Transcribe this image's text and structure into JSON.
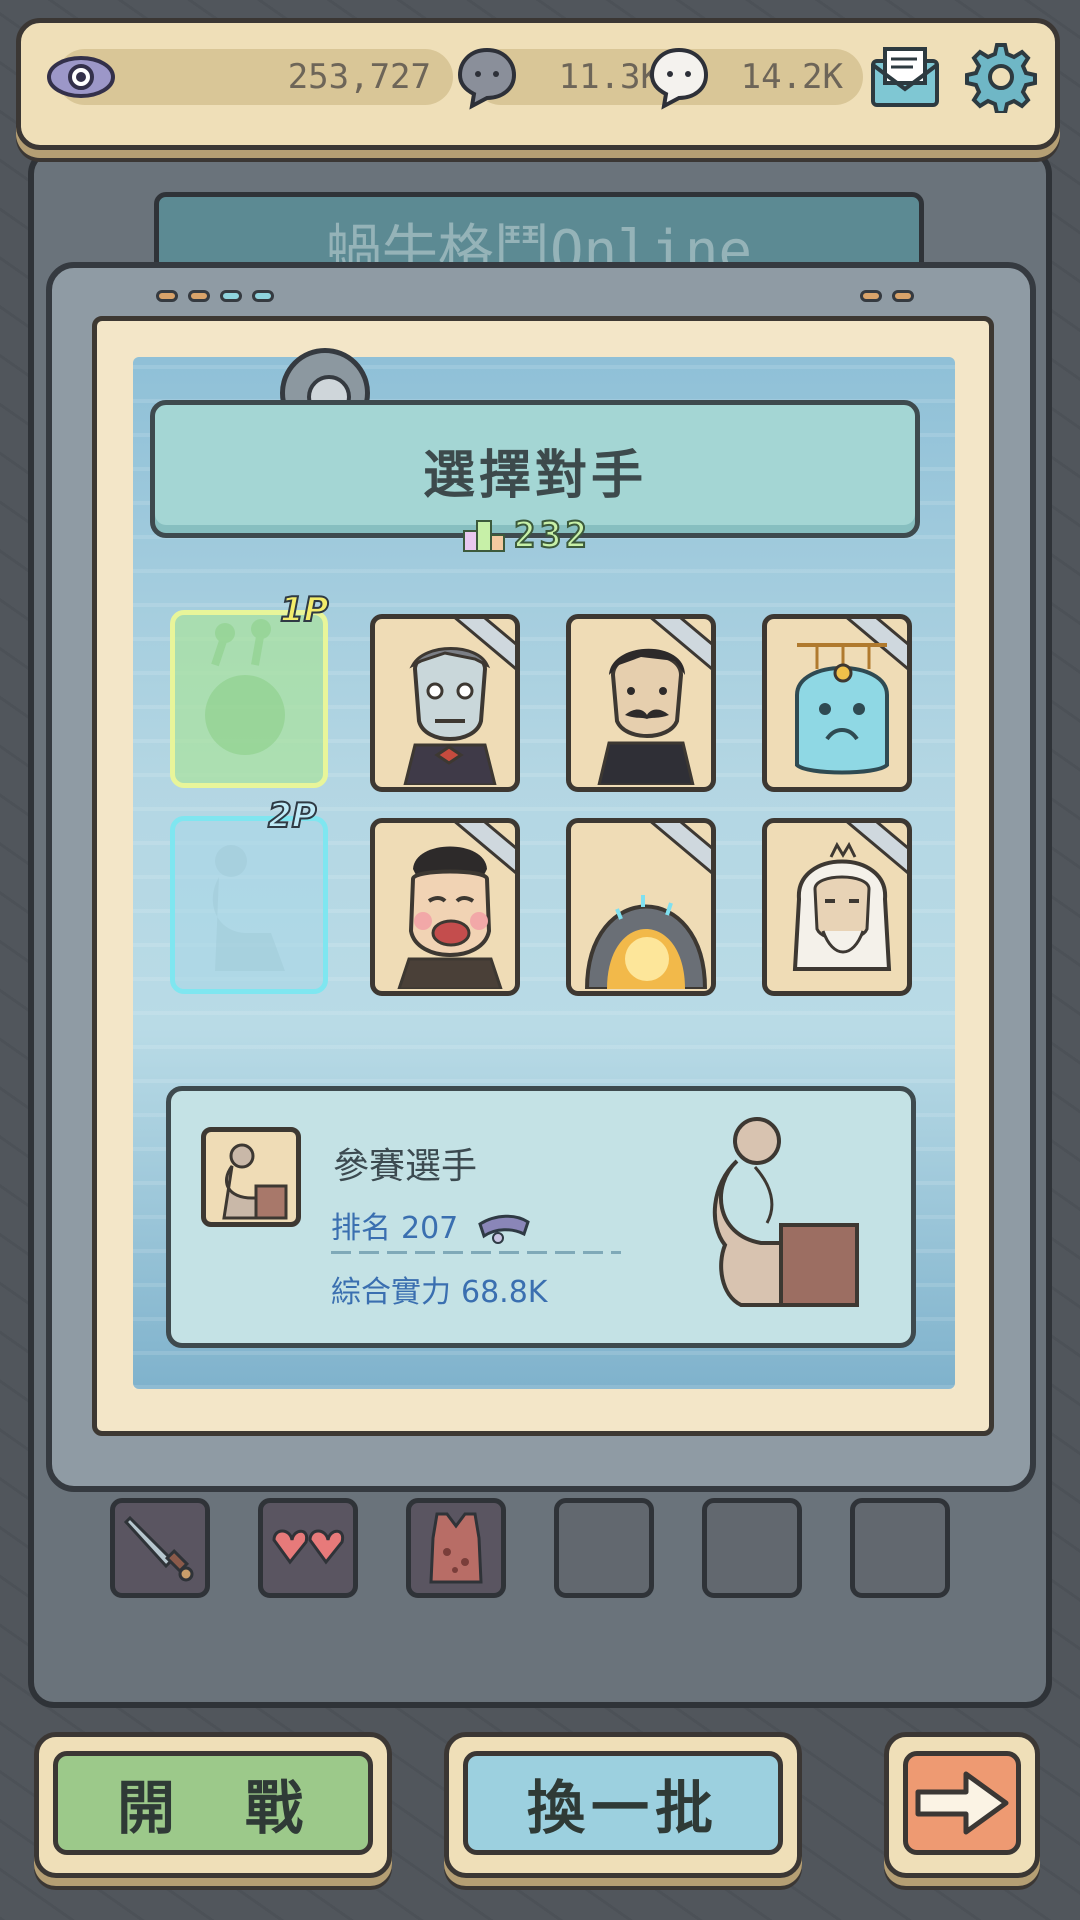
{
  "topbar": {
    "views_icon": "eye-icon",
    "views_value": "253,727",
    "dark_bubble_icon": "dark-speech-bubble-icon",
    "dark_bubble_value": "11.3K",
    "light_bubble_icon": "light-speech-bubble-icon",
    "light_bubble_value": "14.2K",
    "mail_icon": "mail-icon",
    "settings_icon": "gear-icon"
  },
  "background": {
    "screen_text": "蝸牛格鬥Online"
  },
  "dialog": {
    "title": "選擇對手",
    "rank_icon": "podium-icon",
    "rank_value": "232"
  },
  "slots": {
    "p1_label": "1P",
    "p2_label": "2P"
  },
  "opponents": [
    {
      "name": "old-man-vampire-portrait"
    },
    {
      "name": "mustache-gentleman-portrait"
    },
    {
      "name": "blue-ghost-portrait"
    },
    {
      "name": "crying-lady-portrait"
    },
    {
      "name": "golden-portal-portrait"
    },
    {
      "name": "white-haired-sage-portrait"
    }
  ],
  "info": {
    "name": "參賽選手",
    "rank_label": "排名",
    "rank_value": "207",
    "power_label": "綜合實力",
    "power_value": "68.8K"
  },
  "inventory": [
    {
      "icon": "dagger-icon"
    },
    {
      "icon": "heart-glasses-icon"
    },
    {
      "icon": "vest-icon"
    },
    {
      "icon": ""
    },
    {
      "icon": ""
    },
    {
      "icon": ""
    }
  ],
  "buttons": {
    "start": "開　戰",
    "swap": "換一批",
    "next_icon": "arrow-right-icon"
  },
  "colors": {
    "panel_cream": "#efdfb8",
    "start_green": "#9cc98a",
    "swap_blue": "#9cd0df",
    "next_orange": "#ee9a72",
    "text_blue": "#3a6fb0"
  }
}
